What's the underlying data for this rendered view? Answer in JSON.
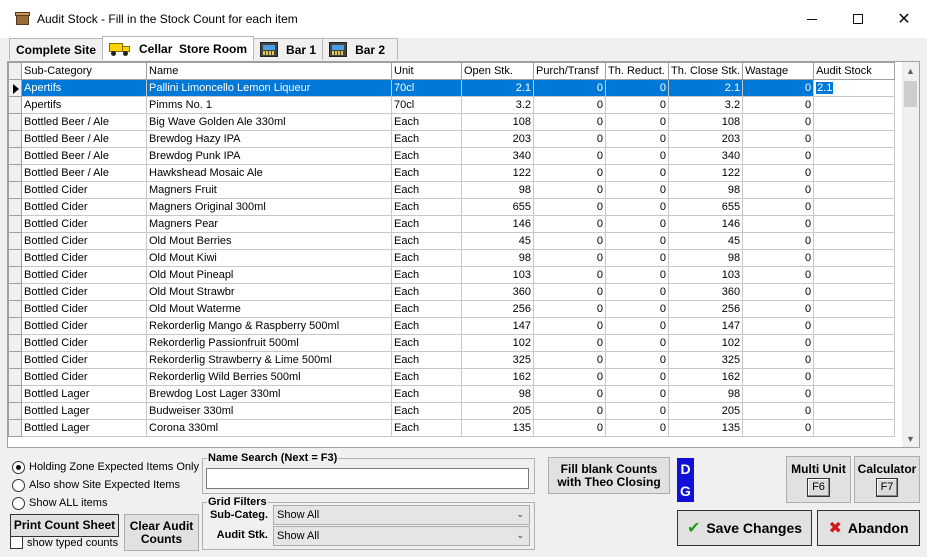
{
  "window": {
    "title": "Audit Stock - Fill in the Stock Count for each item",
    "minimize": "—",
    "maximize": "☐",
    "close": "✕"
  },
  "tabs": [
    {
      "label": "Complete Site",
      "icon": ""
    },
    {
      "label": "Cellar  Store Room",
      "icon": "truck-icon"
    },
    {
      "label": "Bar 1",
      "icon": "till-icon"
    },
    {
      "label": "Bar 2",
      "icon": "till-icon"
    }
  ],
  "grid": {
    "columns": [
      "Sub-Category",
      "Name",
      "Unit",
      "Open Stk.",
      "Purch/Transf",
      "Th. Reduct.",
      "Th. Close Stk.",
      "Wastage",
      "Audit Stock"
    ],
    "rows": [
      [
        "Apertifs",
        "Pallini Limoncello Lemon Liqueur",
        "70cl",
        "2.1",
        "0",
        "0",
        "2.1",
        "0",
        "2.1"
      ],
      [
        "Apertifs",
        "Pimms No. 1",
        "70cl",
        "3.2",
        "0",
        "0",
        "3.2",
        "0",
        ""
      ],
      [
        "Bottled Beer / Ale",
        "Big Wave Golden Ale 330ml",
        "Each",
        "108",
        "0",
        "0",
        "108",
        "0",
        ""
      ],
      [
        "Bottled Beer / Ale",
        "Brewdog Hazy IPA",
        "Each",
        "203",
        "0",
        "0",
        "203",
        "0",
        ""
      ],
      [
        "Bottled Beer / Ale",
        "Brewdog Punk IPA",
        "Each",
        "340",
        "0",
        "0",
        "340",
        "0",
        ""
      ],
      [
        "Bottled Beer / Ale",
        "Hawkshead Mosaic Ale",
        "Each",
        "122",
        "0",
        "0",
        "122",
        "0",
        ""
      ],
      [
        "Bottled Cider",
        "Magners Fruit",
        "Each",
        "98",
        "0",
        "0",
        "98",
        "0",
        ""
      ],
      [
        "Bottled Cider",
        "Magners Original 300ml",
        "Each",
        "655",
        "0",
        "0",
        "655",
        "0",
        ""
      ],
      [
        "Bottled Cider",
        "Magners Pear",
        "Each",
        "146",
        "0",
        "0",
        "146",
        "0",
        ""
      ],
      [
        "Bottled Cider",
        "Old Mout Berries",
        "Each",
        "45",
        "0",
        "0",
        "45",
        "0",
        ""
      ],
      [
        "Bottled Cider",
        "Old Mout Kiwi",
        "Each",
        "98",
        "0",
        "0",
        "98",
        "0",
        ""
      ],
      [
        "Bottled Cider",
        "Old Mout Pineapl",
        "Each",
        "103",
        "0",
        "0",
        "103",
        "0",
        ""
      ],
      [
        "Bottled Cider",
        "Old Mout Strawbr",
        "Each",
        "360",
        "0",
        "0",
        "360",
        "0",
        ""
      ],
      [
        "Bottled Cider",
        "Old Mout Waterme",
        "Each",
        "256",
        "0",
        "0",
        "256",
        "0",
        ""
      ],
      [
        "Bottled Cider",
        "Rekorderlig Mango & Raspberry 500ml",
        "Each",
        "147",
        "0",
        "0",
        "147",
        "0",
        ""
      ],
      [
        "Bottled Cider",
        "Rekorderlig Passionfruit 500ml",
        "Each",
        "102",
        "0",
        "0",
        "102",
        "0",
        ""
      ],
      [
        "Bottled Cider",
        "Rekorderlig Strawberry & Lime 500ml",
        "Each",
        "325",
        "0",
        "0",
        "325",
        "0",
        ""
      ],
      [
        "Bottled Cider",
        "Rekorderlig Wild Berries 500ml",
        "Each",
        "162",
        "0",
        "0",
        "162",
        "0",
        ""
      ],
      [
        "Bottled Lager",
        "Brewdog Lost Lager 330ml",
        "Each",
        "98",
        "0",
        "0",
        "98",
        "0",
        ""
      ],
      [
        "Bottled Lager",
        "Budweiser 330ml",
        "Each",
        "205",
        "0",
        "0",
        "205",
        "0",
        ""
      ],
      [
        "Bottled Lager",
        "Corona 330ml",
        "Each",
        "135",
        "0",
        "0",
        "135",
        "0",
        ""
      ]
    ],
    "selected_row": 0
  },
  "scope": {
    "options": [
      "Holding Zone Expected Items Only",
      "Also show Site Expected Items",
      "Show ALL items"
    ],
    "selected": 0
  },
  "buttons": {
    "print_count_sheet": "Print Count Sheet",
    "clear_audit_counts": "Clear Audit Counts",
    "fill_blank_counts": "Fill blank Counts with Theo Closing",
    "multi_unit": "Multi Unit",
    "multi_unit_key": "F6",
    "calculator": "Calculator",
    "calculator_key": "F7",
    "save_changes": "Save Changes",
    "abandon": "Abandon"
  },
  "show_typed_counts": {
    "label": "show typed counts",
    "checked": false
  },
  "name_search": {
    "legend": "Name Search (Next = F3)",
    "value": ""
  },
  "grid_filters": {
    "legend": "Grid Filters",
    "sub_categ_label": "Sub-Categ.",
    "sub_categ_value": "Show All",
    "audit_stk_label": "Audit Stk.",
    "audit_stk_value": "Show All"
  },
  "badge": {
    "top": "D",
    "bottom": "G",
    "color": "#1010d8"
  },
  "colors": {
    "selection": "#0078d7"
  }
}
